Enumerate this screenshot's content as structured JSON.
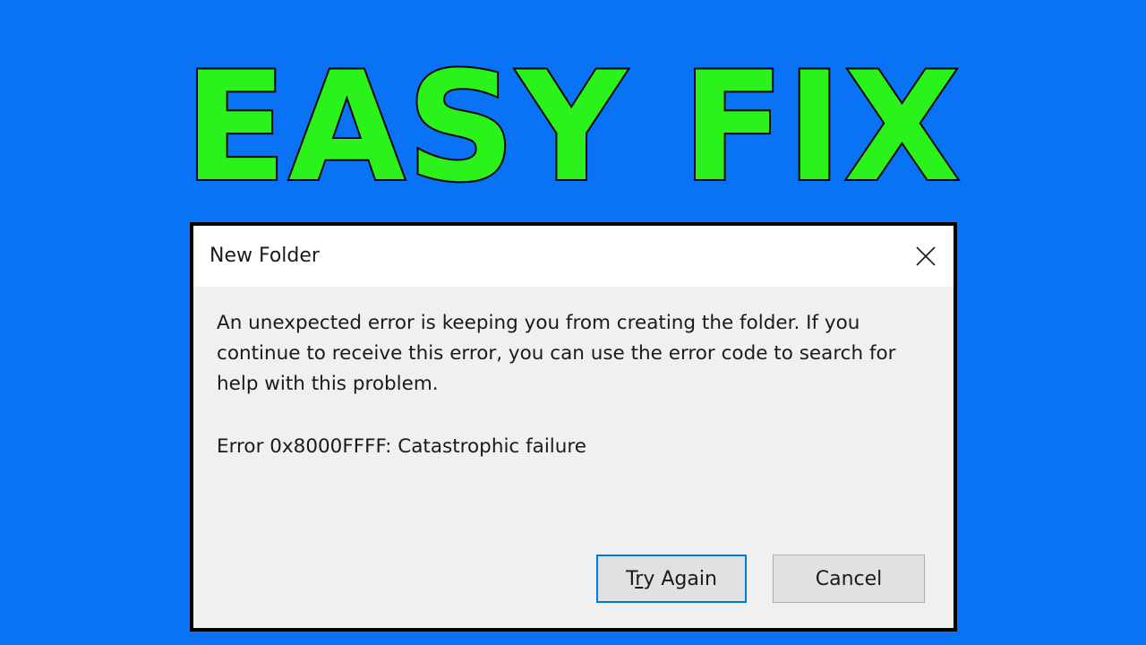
{
  "headline": "EASY FIX",
  "dialog": {
    "title": "New Folder",
    "message": "An unexpected error is keeping you from creating the folder. If you continue to receive this error, you can use the error code to search for help with this problem.",
    "error_code": "Error 0x8000FFFF: Catastrophic failure",
    "close_icon": "close-icon",
    "buttons": {
      "try_again": {
        "label": "Try Again",
        "mnemonic_prefix": "T",
        "mnemonic_char": "r",
        "mnemonic_suffix": "y Again"
      },
      "cancel": {
        "label": "Cancel"
      }
    }
  },
  "colors": {
    "background": "#0a72f5",
    "headline_fill": "#2cf21c",
    "headline_outline": "#0a0a0a",
    "dialog_body": "#f0f0f0",
    "titlebar": "#ffffff",
    "focus_border": "#0078d7"
  }
}
